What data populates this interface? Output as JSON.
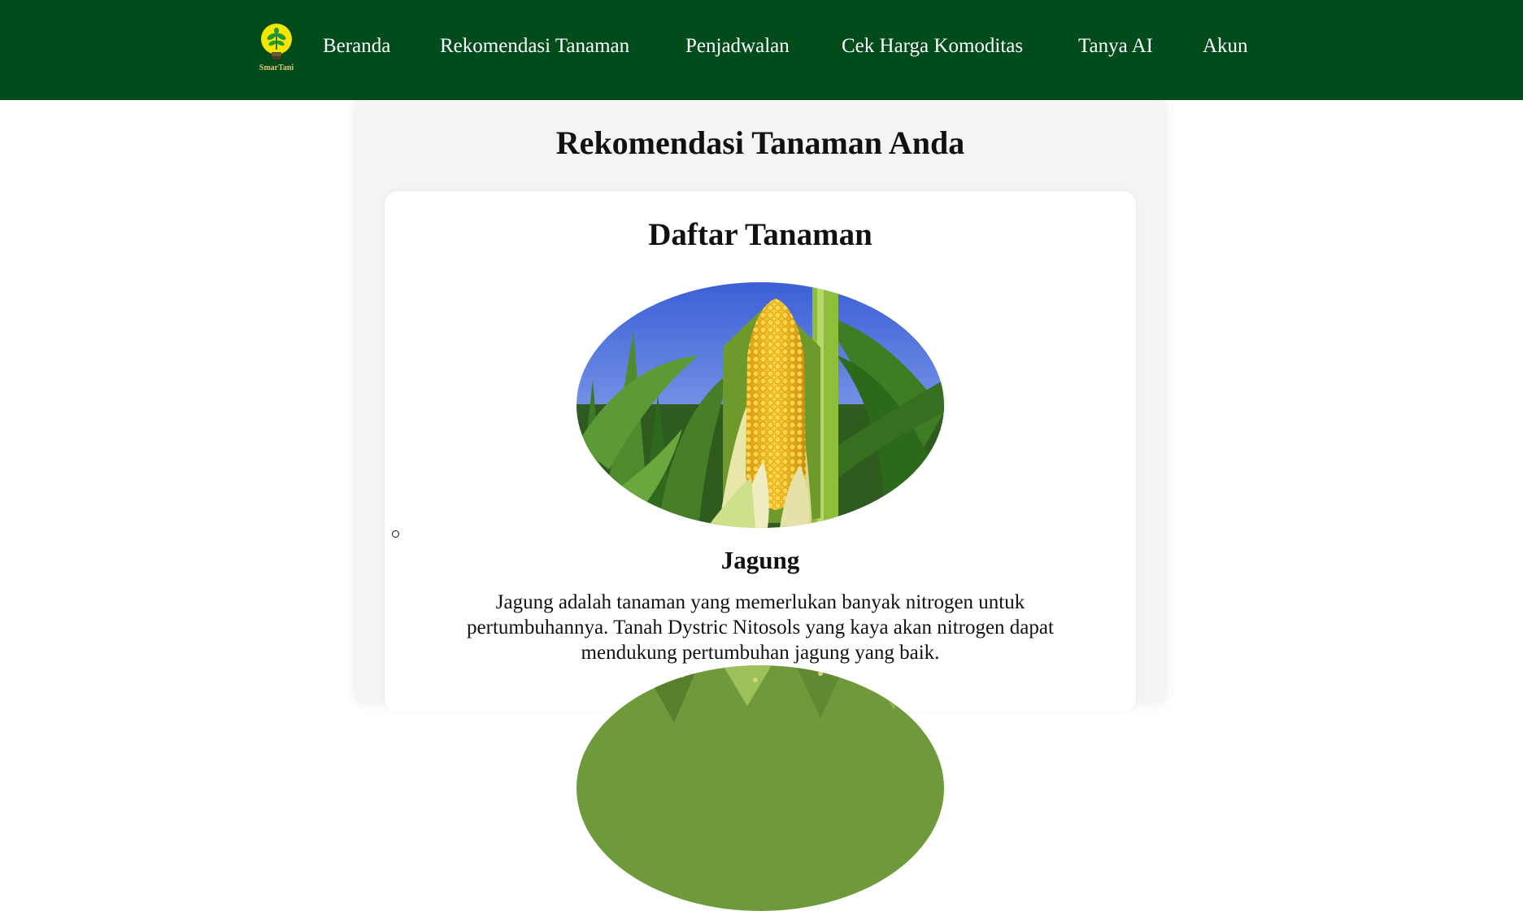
{
  "brand": {
    "logo_text": "SmarTani",
    "icon": "lightbulb-plant-icon",
    "colors": {
      "navbar_bg": "#024c1b",
      "bulb": "#f5e600",
      "logo_text": "#e3c36c"
    }
  },
  "nav": {
    "items": [
      {
        "label": "Beranda"
      },
      {
        "label": "Rekomendasi Tanaman"
      },
      {
        "label": "Penjadwalan"
      },
      {
        "label": "Cek Harga Komoditas"
      },
      {
        "label": "Tanya AI"
      },
      {
        "label": "Akun"
      }
    ]
  },
  "main": {
    "title": "Rekomendasi Tanaman Anda",
    "list_title": "Daftar Tanaman",
    "crops": [
      {
        "name": "Jagung",
        "image": "corn-photo",
        "description": "Jagung adalah tanaman yang memerlukan banyak nitrogen untuk pertumbuhannya. Tanah Dystric Nitosols yang kaya akan nitrogen dapat mendukung pertumbuhan jagung yang baik."
      },
      {
        "image": "rice-plant-photo"
      }
    ]
  }
}
